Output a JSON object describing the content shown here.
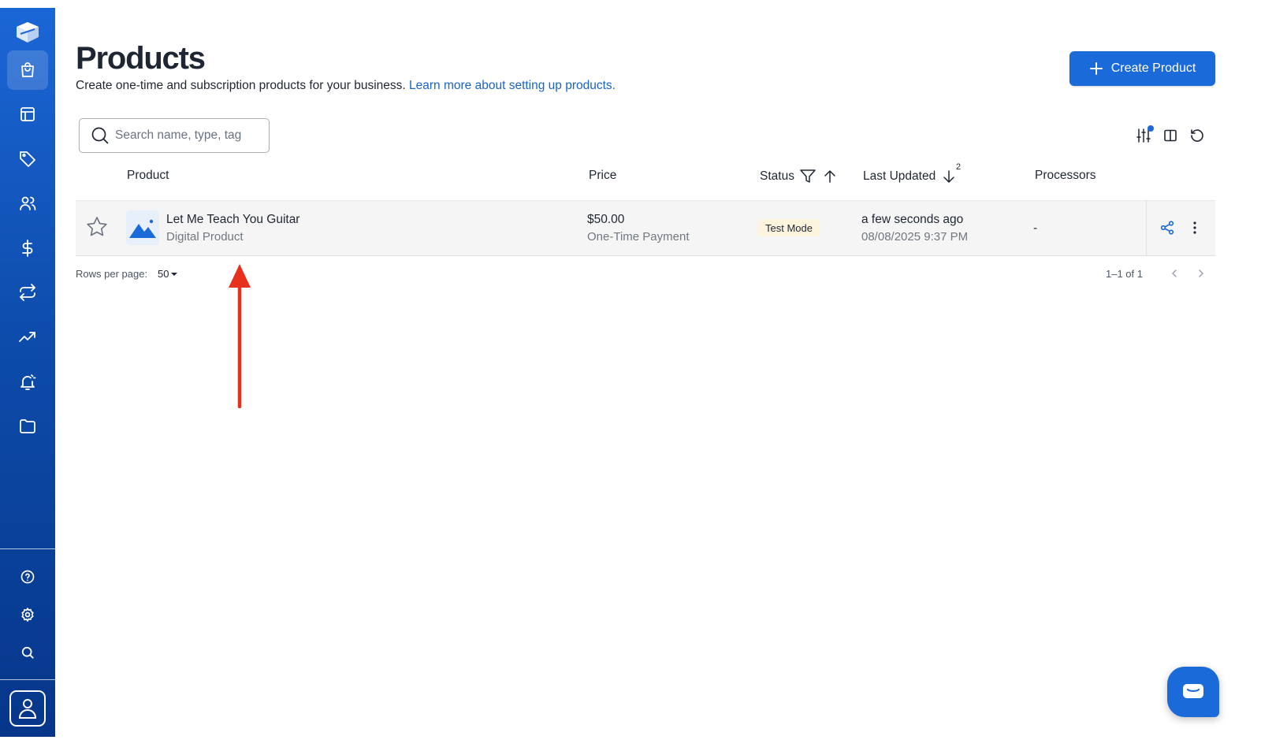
{
  "header": {
    "title": "Products",
    "subtitle": "Create one-time and subscription products for your business.",
    "learn_more_link": "Learn more about setting up products.",
    "create_button": "Create Product"
  },
  "search": {
    "placeholder": "Search name, type, tag"
  },
  "table": {
    "columns": {
      "product": "Product",
      "price": "Price",
      "status": "Status",
      "last_updated": "Last Updated",
      "sort_order": "2",
      "processors": "Processors"
    },
    "rows": [
      {
        "name": "Let Me Teach You Guitar",
        "type": "Digital Product",
        "price": "$50.00",
        "payment_type": "One-Time Payment",
        "status": "Test Mode",
        "updated_relative": "a few seconds ago",
        "updated_date": "08/08/2025 9:37 PM",
        "processors": "-"
      }
    ]
  },
  "pagination": {
    "rows_per_page_label": "Rows per page:",
    "rows_per_page_value": "50",
    "range": "1–1 of 1"
  },
  "sidebar": {
    "items": [
      "products-icon",
      "layout-icon",
      "tag-icon",
      "users-icon",
      "dollar-icon",
      "repeat-icon",
      "trending-icon",
      "bell-icon",
      "folder-icon"
    ],
    "bottom_items": [
      "help-icon",
      "settings-icon",
      "search-icon"
    ]
  },
  "colors": {
    "primary": "#1a6ad9",
    "link": "#1a63c9",
    "sidebar_top": "#1b66d6",
    "sidebar_bottom": "#06368a",
    "badge_bg": "#fdf4de",
    "annotation": "#e8301f"
  }
}
